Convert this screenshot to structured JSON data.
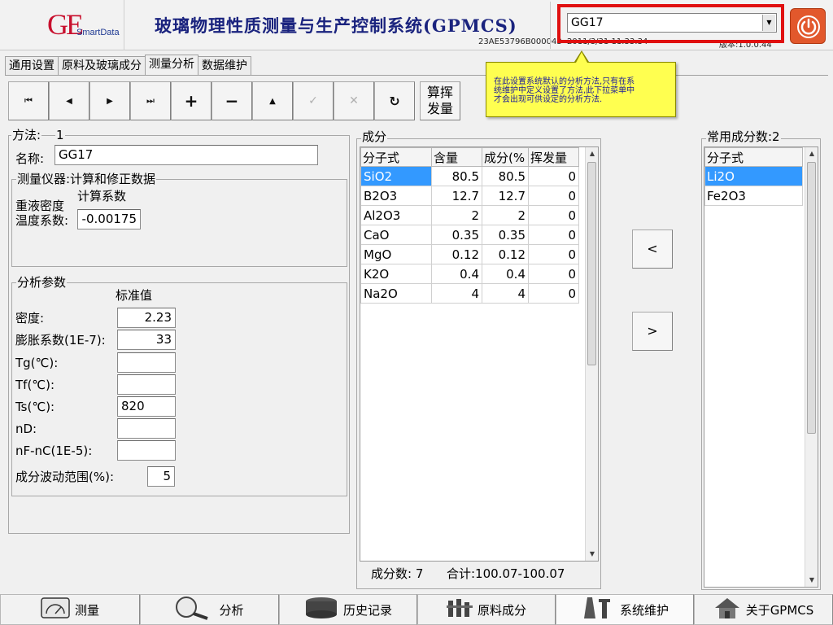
{
  "header": {
    "logo_main": "GE",
    "logo_sub": "SmartData",
    "title": "玻璃物理性质测量与生产控制系统(GPMCS)",
    "serial": "23AE53796B000043",
    "date": "2011/3/31 11:33:34",
    "version": "版本:1.0.0.44",
    "method_select": "GG17"
  },
  "tooltip": {
    "line1": "在此设置系统默认的分析方法,只有在系",
    "line2": "统维护中定义设置了方法,此下拉菜单中",
    "line3": "才会出现可供设定的分析方法."
  },
  "tabs": [
    {
      "label": "通用设置"
    },
    {
      "label": "原料及玻璃成分"
    },
    {
      "label": "测量分析"
    },
    {
      "label": "数据维护"
    }
  ],
  "toolbar": {
    "first": "⏮",
    "prev": "◀",
    "next": "▶",
    "last": "⏭",
    "add": "+",
    "remove": "−",
    "up": "▲",
    "confirm": "✓",
    "cancel": "✕",
    "refresh": "↻",
    "calc_line1": "算挥",
    "calc_line2": "发量"
  },
  "method": {
    "label": "方法:",
    "number": "1",
    "name_label": "名称:",
    "name_value": "GG17"
  },
  "instrument": {
    "title": "测量仪器:计算和修正数据",
    "calc_coef": "计算系数",
    "density_label": "重液密度",
    "temp_label": "温度系数:",
    "temp_value": "-0.00175"
  },
  "params": {
    "title": "分析参数",
    "std_header": "标准值",
    "rows": [
      {
        "label": "密度:",
        "value": "2.23"
      },
      {
        "label": "膨胀系数(1E-7):",
        "value": "33"
      },
      {
        "label": "Tg(℃):",
        "value": ""
      },
      {
        "label": "Tf(℃):",
        "value": ""
      },
      {
        "label": "Ts(℃):",
        "value": "820"
      },
      {
        "label": "nD:",
        "value": ""
      },
      {
        "label": "nF-nC(1E-5):",
        "value": ""
      }
    ],
    "range_label": "成分波动范围(%):",
    "range_value": "5"
  },
  "composition": {
    "title": "成分",
    "headers": [
      "分子式",
      "含量",
      "成分(%",
      "挥发量"
    ],
    "rows": [
      [
        "SiO2",
        "80.5",
        "80.5",
        "0"
      ],
      [
        "B2O3",
        "12.7",
        "12.7",
        "0"
      ],
      [
        "Al2O3",
        "2",
        "2",
        "0"
      ],
      [
        "CaO",
        "0.35",
        "0.35",
        "0"
      ],
      [
        "MgO",
        "0.12",
        "0.12",
        "0"
      ],
      [
        "K2O",
        "0.4",
        "0.4",
        "0"
      ],
      [
        "Na2O",
        "4",
        "4",
        "0"
      ]
    ],
    "count_text": "成分数: 7",
    "total_text": "合计:100.07-100.07"
  },
  "move": {
    "left": "<",
    "right": ">"
  },
  "common": {
    "title": "常用成分数:2",
    "header": "分子式",
    "items": [
      "Li2O",
      "Fe2O3"
    ]
  },
  "nav": [
    {
      "label": "测量",
      "icon": "gauge-icon"
    },
    {
      "label": "分析",
      "icon": "magnifier-icon"
    },
    {
      "label": "历史记录",
      "icon": "database-icon"
    },
    {
      "label": "原料成分",
      "icon": "ingredients-icon"
    },
    {
      "label": "系统维护",
      "icon": "tools-icon"
    },
    {
      "label": "关于GPMCS",
      "icon": "home-icon"
    }
  ],
  "colors": {
    "selection": "#3399ff",
    "highlight_border": "#e01010",
    "tooltip_bg": "#ffff50",
    "title_blue": "#1a237e",
    "power_btn": "#e2582c"
  }
}
